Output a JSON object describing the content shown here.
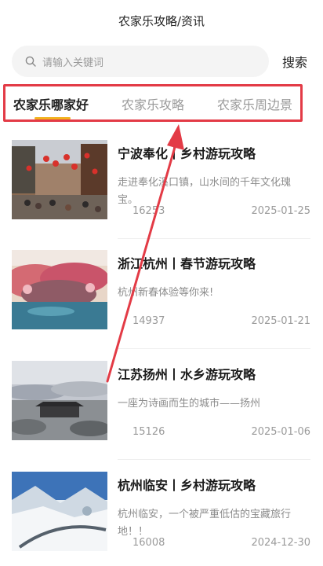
{
  "header": {
    "title": "农家乐攻略/资讯"
  },
  "search": {
    "placeholder": "请输入关键词",
    "button_label": "搜索"
  },
  "tabs": [
    {
      "label": "农家乐哪家好",
      "active": true
    },
    {
      "label": "农家乐攻略",
      "active": false
    },
    {
      "label": "农家乐周边景",
      "active": false
    }
  ],
  "articles": [
    {
      "title": "宁波奉化丨乡村游玩攻略",
      "desc": "走进奉化溪口镇，山水间的千年文化瑰宝。",
      "views": "16253",
      "date": "2025-01-25"
    },
    {
      "title": "浙江杭州丨春节游玩攻略",
      "desc": "杭州新春体验等你来!",
      "views": "14937",
      "date": "2025-01-21"
    },
    {
      "title": "江苏扬州丨水乡游玩攻略",
      "desc": "一座为诗画而生的城市——扬州",
      "views": "15126",
      "date": "2025-01-06"
    },
    {
      "title": "杭州临安丨乡村游玩攻略",
      "desc": "杭州临安，一个被严重低估的宝藏旅行地！！",
      "views": "16008",
      "date": "2024-12-30"
    }
  ],
  "colors": {
    "accent": "#f2b21e",
    "highlight_box": "#e33b46",
    "arrow": "#e33b46"
  }
}
